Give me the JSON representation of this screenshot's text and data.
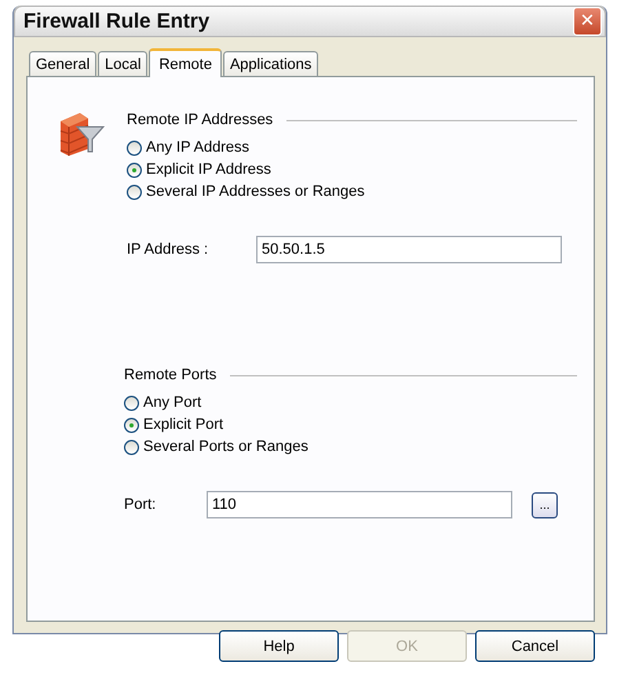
{
  "window": {
    "title": "Firewall Rule Entry",
    "close": "✕"
  },
  "tabs": [
    {
      "label": "General",
      "selected": false
    },
    {
      "label": "Local",
      "selected": false
    },
    {
      "label": "Remote",
      "selected": true
    },
    {
      "label": "Applications",
      "selected": false
    }
  ],
  "ip_group": {
    "title": "Remote IP Addresses",
    "options": [
      {
        "label": "Any IP Address",
        "selected": false
      },
      {
        "label": "Explicit IP Address",
        "selected": true
      },
      {
        "label": "Several IP Addresses or Ranges",
        "selected": false
      }
    ],
    "field": {
      "label": "IP Address :",
      "value": "50.50.1.5"
    }
  },
  "port_group": {
    "title": "Remote Ports",
    "options": [
      {
        "label": "Any Port",
        "selected": false
      },
      {
        "label": "Explicit Port",
        "selected": true
      },
      {
        "label": "Several Ports or Ranges",
        "selected": false
      }
    ],
    "field": {
      "label": "Port:",
      "value": "110"
    },
    "browse": "..."
  },
  "buttons": [
    {
      "label": "Help",
      "disabled": false
    },
    {
      "label": "OK",
      "disabled": true
    },
    {
      "label": "Cancel",
      "disabled": false
    }
  ]
}
